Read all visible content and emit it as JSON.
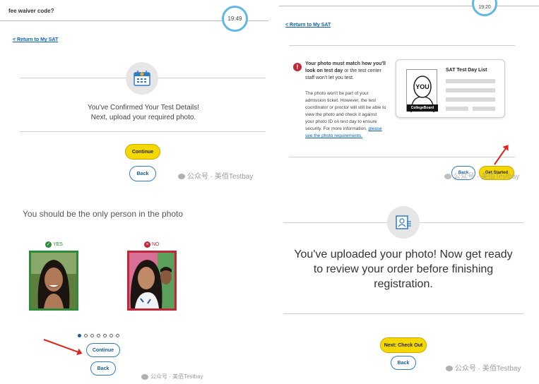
{
  "panel1": {
    "header_text": "fee waiver code?",
    "timer": "19:49",
    "return_link": "< Return to My SAT",
    "message_line1": "You've Confirmed Your Test Details!",
    "message_line2": "Next, upload your required photo.",
    "continue_label": "Continue",
    "back_label": "Back",
    "watermark": "公众号 · 美佰Testbay"
  },
  "panel2": {
    "timer": "19:20",
    "return_link": "< Return to My SAT",
    "warning_bold": "Your photo must match how you'll look on test day",
    "warning_rest": " or the test center staff won't let you test.",
    "body_text": "The photo won't be part of your admission ticket. However, the test coordinator or proctor will still be able to view the photo and check it against your photo ID on test day to ensure security. For more information, ",
    "body_link": "please see the photo requirements.",
    "card_title": "SAT Test Day List",
    "card_you": "YOU",
    "card_brand": "CollegeBoard",
    "back_label": "Back",
    "get_started_label": "Get Started",
    "watermark": "公众号 · 美佰Testbay"
  },
  "panel3": {
    "heading": "You should be the only person in the photo",
    "yes_label": "YES",
    "no_label": "NO",
    "continue_label": "Continue",
    "back_label": "Back",
    "watermark": "公众号 · 美佰Testbay"
  },
  "panel4": {
    "message": "You've uploaded your photo! Now get ready to review your order before finishing registration.",
    "checkout_label": "Next: Check Out",
    "back_label": "Back",
    "watermark": "公众号 · 美佰Testbay"
  },
  "colors": {
    "accent_yellow": "#f5d800",
    "link_blue": "#0a5fb5",
    "timer_ring": "#5fb8e6",
    "yes_green": "#2e8b3a",
    "no_red": "#c0283a",
    "arrow_red": "#e0231c"
  }
}
